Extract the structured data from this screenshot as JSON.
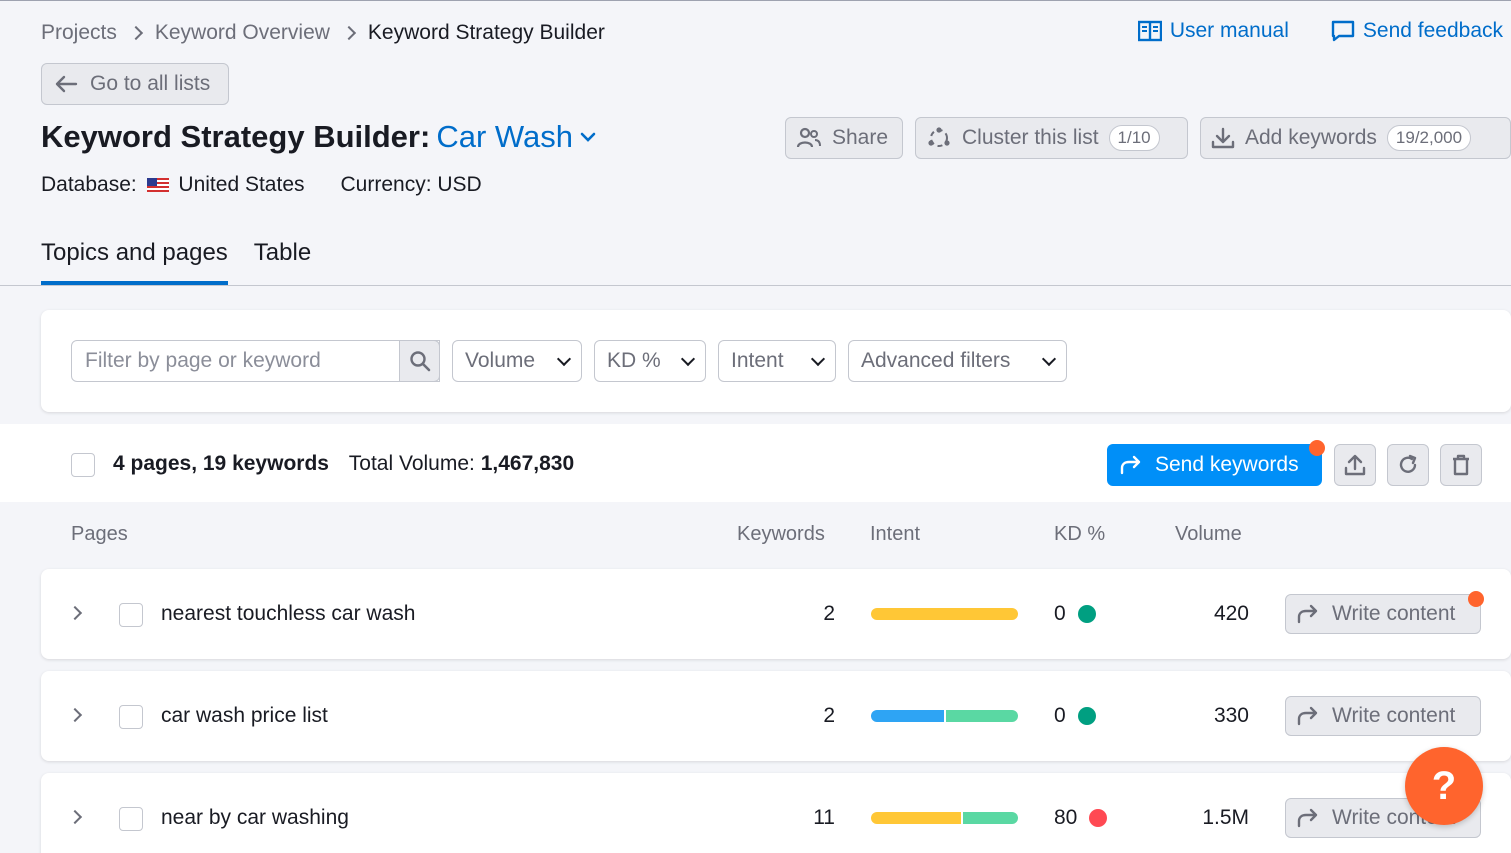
{
  "breadcrumb": [
    "Projects",
    "Keyword Overview",
    "Keyword Strategy Builder"
  ],
  "toplinks": {
    "manual": "User manual",
    "feedback": "Send feedback"
  },
  "back_label": "Go to all lists",
  "title": {
    "prefix": "Keyword Strategy Builder:",
    "list_name": "Car Wash"
  },
  "meta": {
    "db_label": "Database:",
    "db_value": "United States",
    "currency": "Currency: USD"
  },
  "header_buttons": {
    "share": "Share",
    "cluster": "Cluster this list",
    "cluster_count": "1/10",
    "add": "Add keywords",
    "add_count": "19/2,000"
  },
  "tabs": [
    "Topics and pages",
    "Table"
  ],
  "filters": {
    "search_placeholder": "Filter by page or keyword",
    "volume": "Volume",
    "kd": "KD %",
    "intent": "Intent",
    "advanced": "Advanced filters"
  },
  "summary": {
    "pages_keywords": "4 pages, 19 keywords",
    "total_label": "Total Volume:",
    "total_value": "1,467,830",
    "send": "Send keywords"
  },
  "columns": [
    "Pages",
    "Keywords",
    "Intent",
    "KD %",
    "Volume"
  ],
  "rows": [
    {
      "name": "nearest touchless car wash",
      "keywords": "2",
      "kd": "0",
      "volume": "420",
      "action": "Write content",
      "intent": [
        {
          "color": "#ffc736",
          "share": 1
        }
      ],
      "kd_color": "#009f81",
      "badge": true
    },
    {
      "name": "car wash price list",
      "keywords": "2",
      "kd": "0",
      "volume": "330",
      "action": "Write content",
      "intent": [
        {
          "color": "#2ea4f4",
          "share": 0.5
        },
        {
          "color": "#5ad8a3",
          "share": 0.5
        }
      ],
      "kd_color": "#009f81",
      "badge": false
    },
    {
      "name": "near by car washing",
      "keywords": "11",
      "kd": "80",
      "volume": "1.5M",
      "action": "Write content",
      "intent": [
        {
          "color": "#ffc736",
          "share": 0.62
        },
        {
          "color": "#5ad8a3",
          "share": 0.38
        }
      ],
      "kd_color": "#ff4953",
      "badge": false
    }
  ],
  "help_label": "?",
  "colors": {
    "accent": "#006dca",
    "primary_button": "#008ff8",
    "badge": "#ff642d"
  }
}
